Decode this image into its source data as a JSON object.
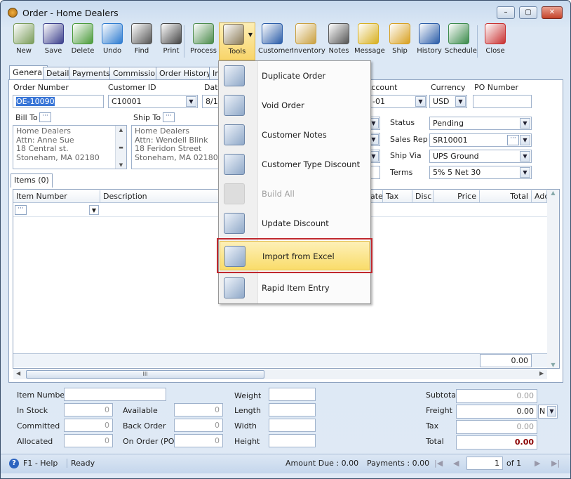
{
  "window": {
    "title": "Order - Home Dealers",
    "min": "–",
    "max": "▢",
    "close": "✕"
  },
  "toolbar": [
    {
      "label": "New",
      "icon": "new-icon",
      "color": "#7a9c5a"
    },
    {
      "label": "Save",
      "icon": "save-icon",
      "color": "#3b3f8c"
    },
    {
      "label": "Delete",
      "icon": "recycle-bin-icon",
      "color": "#4a9a3a"
    },
    {
      "label": "Undo",
      "icon": "undo-icon",
      "color": "#2d7bd0"
    },
    {
      "label": "Find",
      "icon": "binoculars-icon",
      "color": "#555"
    },
    {
      "label": "Print",
      "icon": "printer-icon",
      "color": "#444"
    },
    {
      "label": "Process",
      "icon": "process-icon",
      "color": "#4b8b4b"
    },
    {
      "label": "Tools",
      "icon": "tools-icon",
      "color": "#8a7a55"
    },
    {
      "label": "Customer",
      "icon": "customer-icon",
      "color": "#2a5ca8"
    },
    {
      "label": "Inventory",
      "icon": "inventory-icon",
      "color": "#c9a040"
    },
    {
      "label": "Notes",
      "icon": "notes-icon",
      "color": "#555"
    },
    {
      "label": "Message",
      "icon": "message-icon",
      "color": "#d8b020"
    },
    {
      "label": "Ship",
      "icon": "ship-icon",
      "color": "#d8a020"
    },
    {
      "label": "History",
      "icon": "history-icon",
      "color": "#2a5ca8"
    },
    {
      "label": "Schedule",
      "icon": "schedule-icon",
      "color": "#3a8a4a"
    },
    {
      "label": "Close",
      "icon": "close-icon",
      "color": "#c83030"
    }
  ],
  "tabs": [
    "General",
    "Detail",
    "Payments",
    "Commission",
    "Order History",
    "In"
  ],
  "form": {
    "order_number_label": "Order Number",
    "order_number": "OE-10090",
    "customer_id_label": "Customer ID",
    "customer_id": "C10001",
    "date_label": "Date",
    "date": "8/1",
    "account_label": "Account",
    "account": "-01",
    "currency_label": "Currency",
    "currency": "USD",
    "po_number_label": "PO Number",
    "po_number": "",
    "bill_to_label": "Bill To",
    "bill_to": [
      "Home Dealers",
      "Attn: Anne Sue",
      "18 Central st.",
      "Stoneham, MA 02180"
    ],
    "ship_to_label": "Ship To",
    "ship_to": [
      "Home Dealers",
      "Attn: Wendell Blink",
      "18 Feridon Street",
      "Stoneham, MA 02180"
    ],
    "status_label": "Status",
    "status": "Pending",
    "sales_rep_label": "Sales Rep",
    "sales_rep": "SR10001",
    "ship_via_label": "Ship Via",
    "ship_via": "UPS Ground",
    "terms_label": "Terms",
    "terms": "5% 5 Net 30"
  },
  "items_tab": "Items (0)",
  "grid": {
    "columns": [
      "Item Number",
      "Description",
      "ate",
      "Tax",
      "Disc",
      "Price",
      "Total",
      "Addi"
    ],
    "footer_total": "0.00",
    "hscroll_grip": "III"
  },
  "tools_menu": {
    "items": [
      {
        "label": "Duplicate Order",
        "icon": "duplicate-order-icon",
        "disabled": false
      },
      {
        "label": "Void Order",
        "icon": "void-order-icon",
        "disabled": false
      },
      {
        "label": "Customer Notes",
        "icon": "customer-notes-icon",
        "disabled": false
      },
      {
        "label": "Customer Type Discount",
        "icon": "customer-type-discount-icon",
        "disabled": false
      },
      {
        "label": "Build All",
        "icon": "build-all-icon",
        "disabled": true
      },
      {
        "label": "Update Discount",
        "icon": "update-discount-icon",
        "disabled": false
      },
      {
        "label": "Import from Excel",
        "icon": "import-excel-icon",
        "disabled": false,
        "highlighted": true
      },
      {
        "label": "Rapid Item Entry",
        "icon": "rapid-item-entry-icon",
        "disabled": false
      }
    ]
  },
  "details": {
    "item_number_label": "Item Number",
    "item_number": "",
    "in_stock_label": "In Stock",
    "in_stock": "0",
    "committed_label": "Committed",
    "committed": "0",
    "allocated_label": "Allocated",
    "allocated": "0",
    "available_label": "Available",
    "available": "0",
    "back_order_label": "Back Order",
    "back_order": "0",
    "on_order_label": "On Order (PO)",
    "on_order": "0",
    "weight_label": "Weight",
    "length_label": "Length",
    "width_label": "Width",
    "height_label": "Height",
    "subtotal_label": "Subtotal",
    "subtotal": "0.00",
    "freight_label": "Freight",
    "freight": "0.00",
    "freight_code": "N",
    "tax_label": "Tax",
    "tax": "0.00",
    "total_label": "Total",
    "total": "0.00"
  },
  "status_bar": {
    "help": "F1 - Help",
    "status": "Ready",
    "amount_due": "Amount Due : 0.00",
    "payments": "Payments : 0.00",
    "page": "1",
    "of": "of 1"
  },
  "colors": {
    "highlight": "#f9dc6a",
    "highlight_border": "#c0282e",
    "total": "#8b0000",
    "selection": "#3875d7"
  }
}
